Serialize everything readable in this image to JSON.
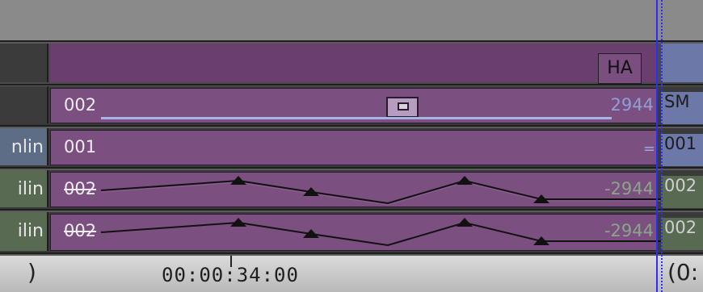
{
  "header": {
    "clip_label": "HA"
  },
  "tracks": {
    "v1": {
      "label": "",
      "clip_name": "002",
      "clip_end": "2944",
      "next_clip": "SM"
    },
    "v2": {
      "label": "nlin",
      "clip_name": "001",
      "clip_end": "",
      "next_clip": "001"
    },
    "a1": {
      "label": "ilin",
      "clip_name": "002",
      "clip_end": "-2944",
      "next_clip": "002"
    },
    "a2": {
      "label": "ilin",
      "clip_name": "002",
      "clip_end": "-2944",
      "next_clip": "002"
    }
  },
  "timeline": {
    "timecode": "00:00:34:00",
    "left_bracket": ")",
    "right_bracket": "(0:"
  },
  "colors": {
    "clip": "#7b4f80",
    "cursor": "#2c2cff",
    "rubberband": "#111111"
  }
}
